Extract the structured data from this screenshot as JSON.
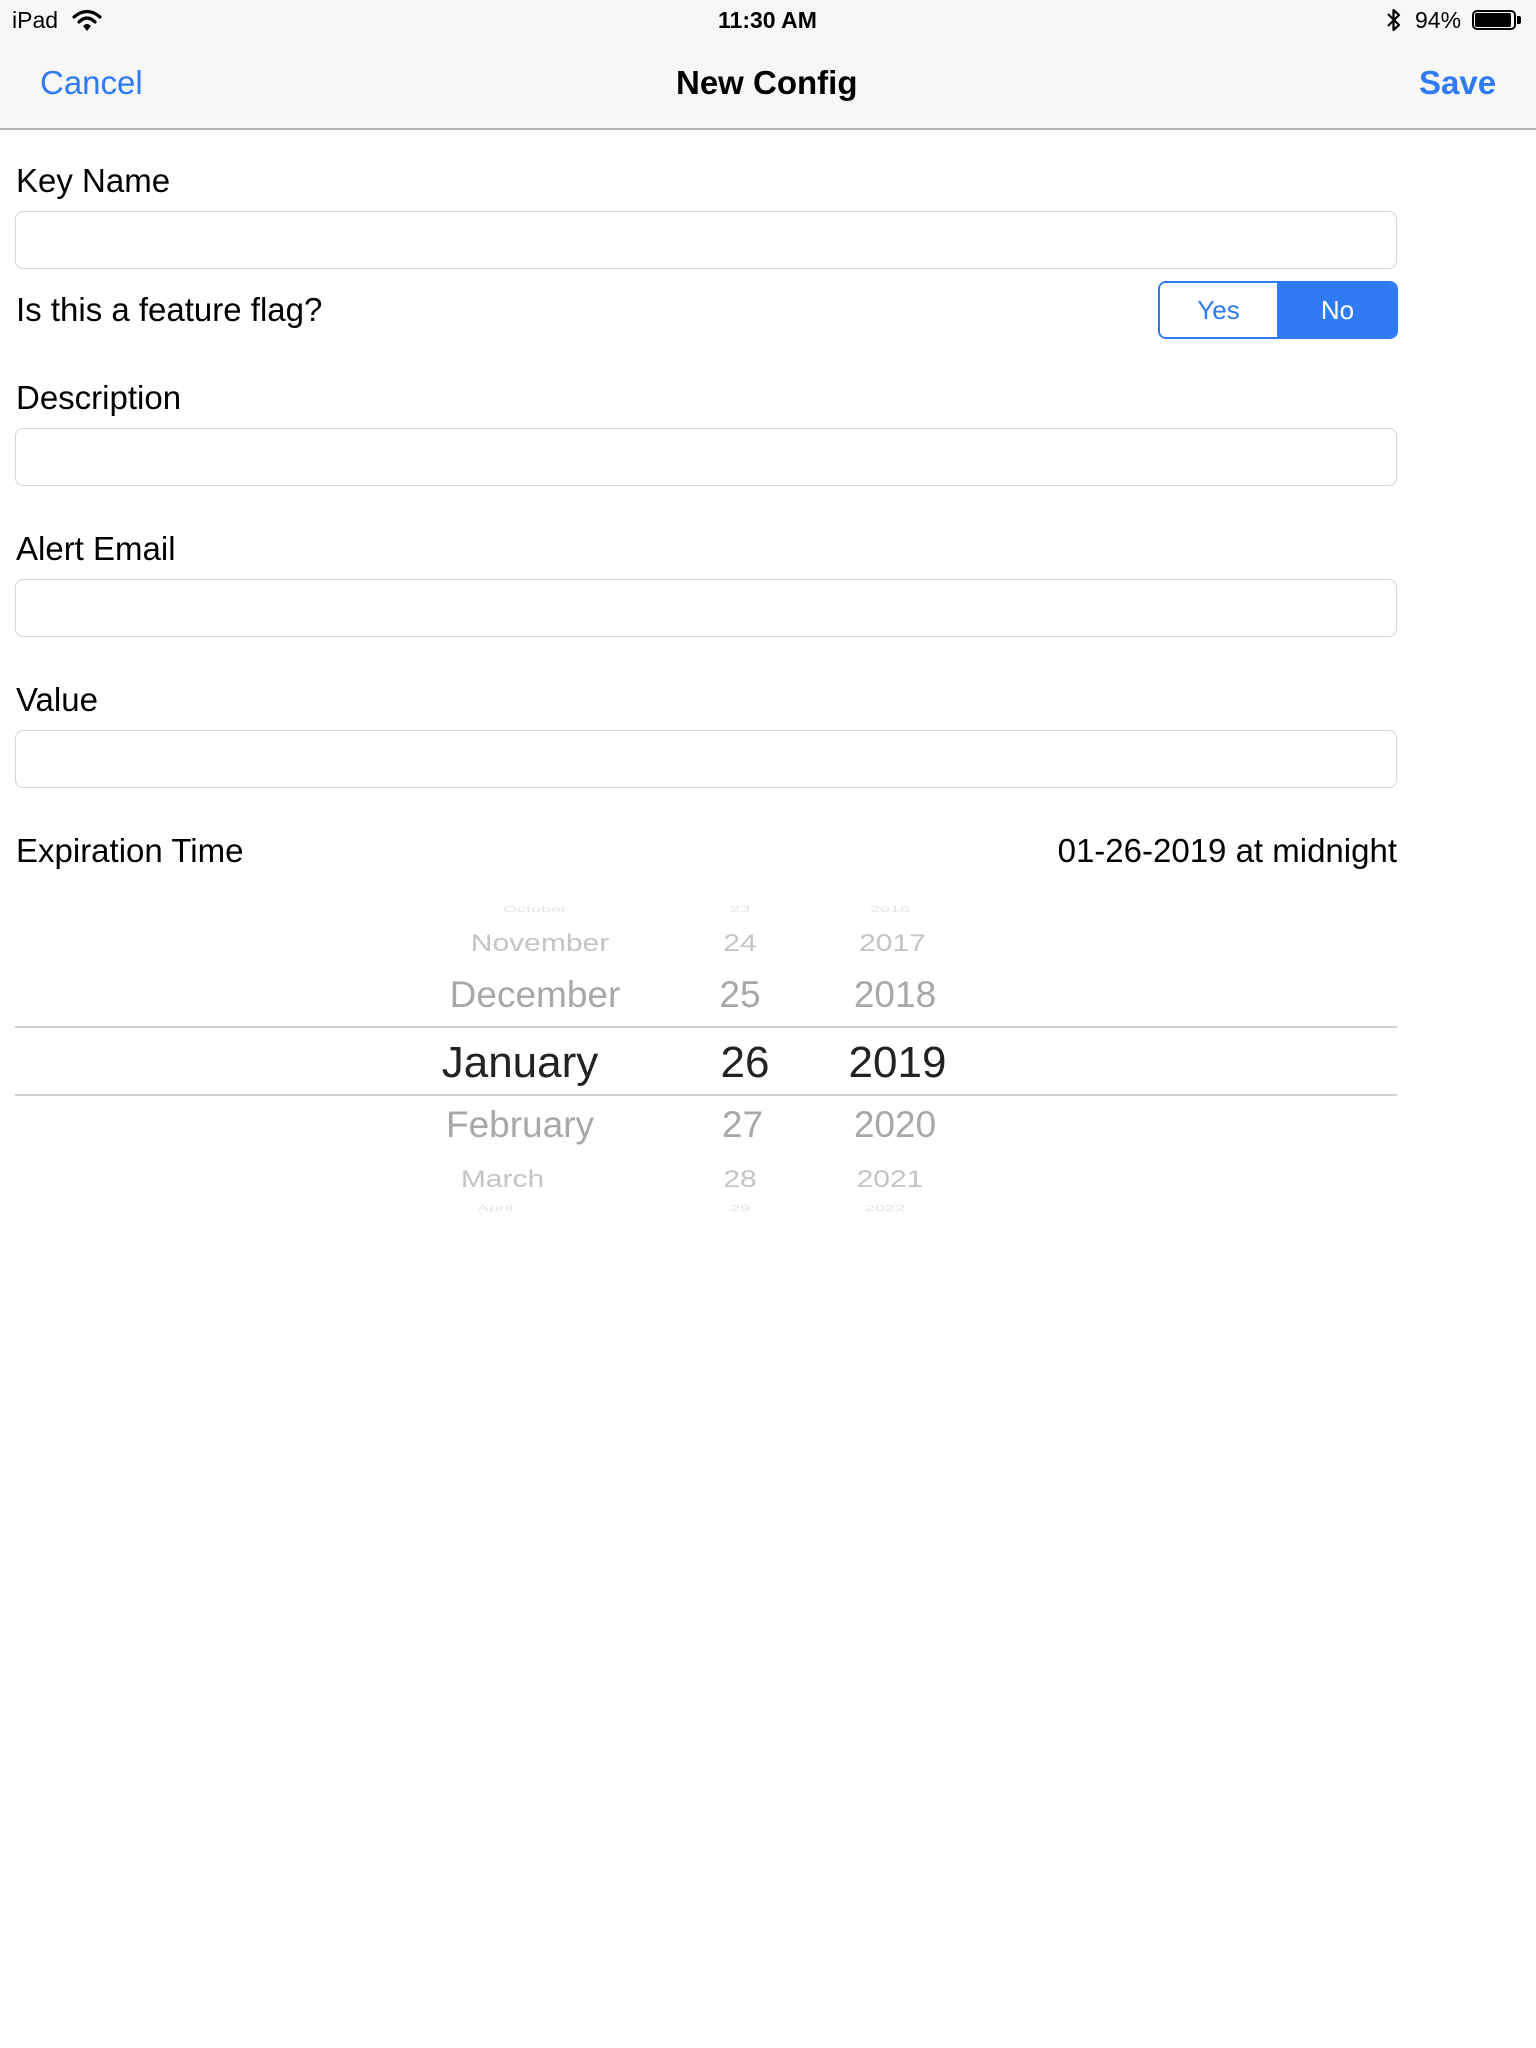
{
  "status_bar": {
    "device": "iPad",
    "time": "11:30 AM",
    "battery_percent": "94%",
    "battery_level": 0.94,
    "icons": [
      "wifi-icon",
      "bluetooth-icon",
      "battery-icon"
    ]
  },
  "nav": {
    "cancel_label": "Cancel",
    "title": "New Config",
    "save_label": "Save"
  },
  "colors": {
    "accent": "#2f7bf6",
    "border": "#d4d4d4",
    "picker_faded": "#b3b3b3"
  },
  "form": {
    "key_name": {
      "label": "Key Name",
      "value": ""
    },
    "feature_flag": {
      "label": "Is this a feature flag?",
      "options": [
        "Yes",
        "No"
      ],
      "selected": "No"
    },
    "description": {
      "label": "Description",
      "value": ""
    },
    "alert_email": {
      "label": "Alert Email",
      "value": ""
    },
    "value": {
      "label": "Value",
      "value": ""
    },
    "expiration": {
      "label": "Expiration Time",
      "value": "01-26-2019 at midnight"
    }
  },
  "picker": {
    "months": [
      "October",
      "November",
      "December",
      "January",
      "February",
      "March",
      "April"
    ],
    "days": [
      "23",
      "24",
      "25",
      "26",
      "27",
      "28",
      "29"
    ],
    "years": [
      "2016",
      "2017",
      "2018",
      "2019",
      "2020",
      "2021",
      "2022"
    ],
    "selected": {
      "month": "January",
      "day": "26",
      "year": "2019"
    }
  }
}
